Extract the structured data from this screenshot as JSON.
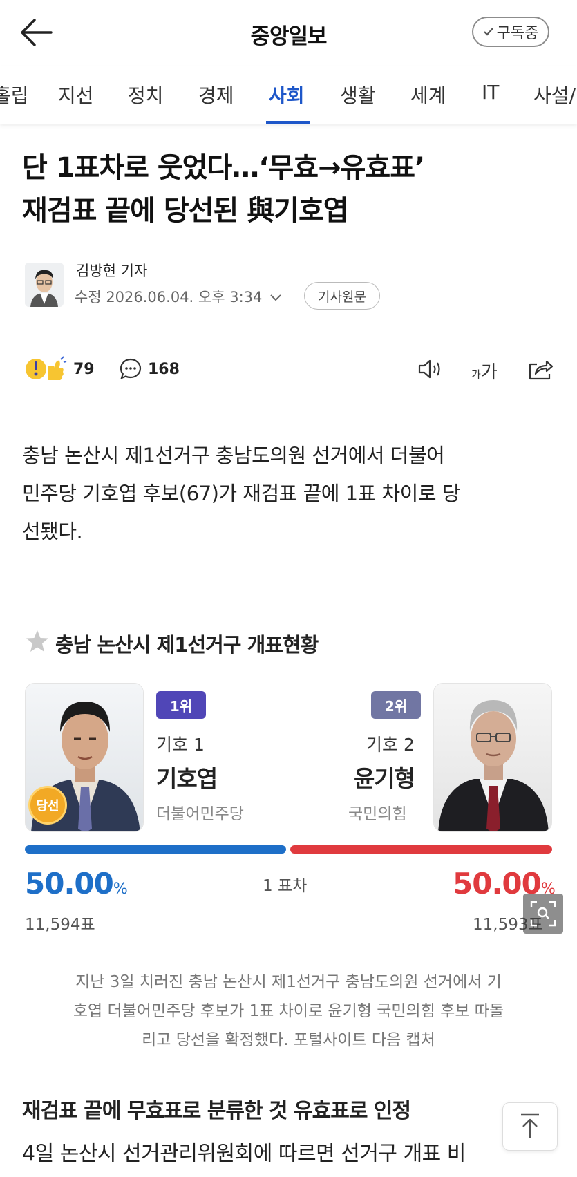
{
  "header": {
    "brand": "중앙일보",
    "subscribe_label": "구독중"
  },
  "nav": {
    "tabs": [
      "홀립",
      "지선",
      "정치",
      "경제",
      "사회",
      "생활",
      "세계",
      "IT",
      "사설/"
    ],
    "active": "사회"
  },
  "article": {
    "headline_lines": [
      "단 1표차로 웃었다…‘무효→유효표’",
      "재검표 끝에 당선된 與기호엽"
    ],
    "author": "김방현 기자",
    "date": "수정 2026.06.04. 오후 3:34",
    "original_label": "기사원문",
    "reactions": "79",
    "comments": "168",
    "fontsize_small": "가",
    "fontsize_large": "가",
    "lead_lines": [
      "충남 논산시 제1선거구 충남도의원 선거에서 더불어",
      "민주당 기호엽 후보(67)가 재검표 끝에 1표 차이로 당",
      "선됐다."
    ]
  },
  "election_card": {
    "title": "충남 논산시 제1선거구 개표현황",
    "diff_label": "1 표차",
    "winner_badge": "당선",
    "candidates": [
      {
        "rank": "1위",
        "number": "기호 1",
        "name": "기호엽",
        "party": "더불어민주당",
        "pct": "50.00",
        "pct_unit": "%",
        "votes": "11,594표",
        "color": "#1e6fc8"
      },
      {
        "rank": "2위",
        "number": "기호 2",
        "name": "윤기형",
        "party": "국민의힘",
        "pct": "50.00",
        "pct_unit": "%",
        "votes": "11,593표",
        "color": "#e03a3e"
      }
    ]
  },
  "caption_lines": [
    "지난 3일 치러진 충남 논산시 제1선거구 충남도의원 선거에서 기",
    "호엽 더불어민주당 후보가 1표 차이로 윤기형 국민의힘 후보 따돌",
    "리고 당선을 확정했다. 포털사이트 다음 캡처"
  ],
  "subheading": "재검표 끝에 무효표로 분류한 것 유효표로 인정",
  "body_line": "4일 논산시 선거관리위원회에 따르면 선거구 개표 비"
}
